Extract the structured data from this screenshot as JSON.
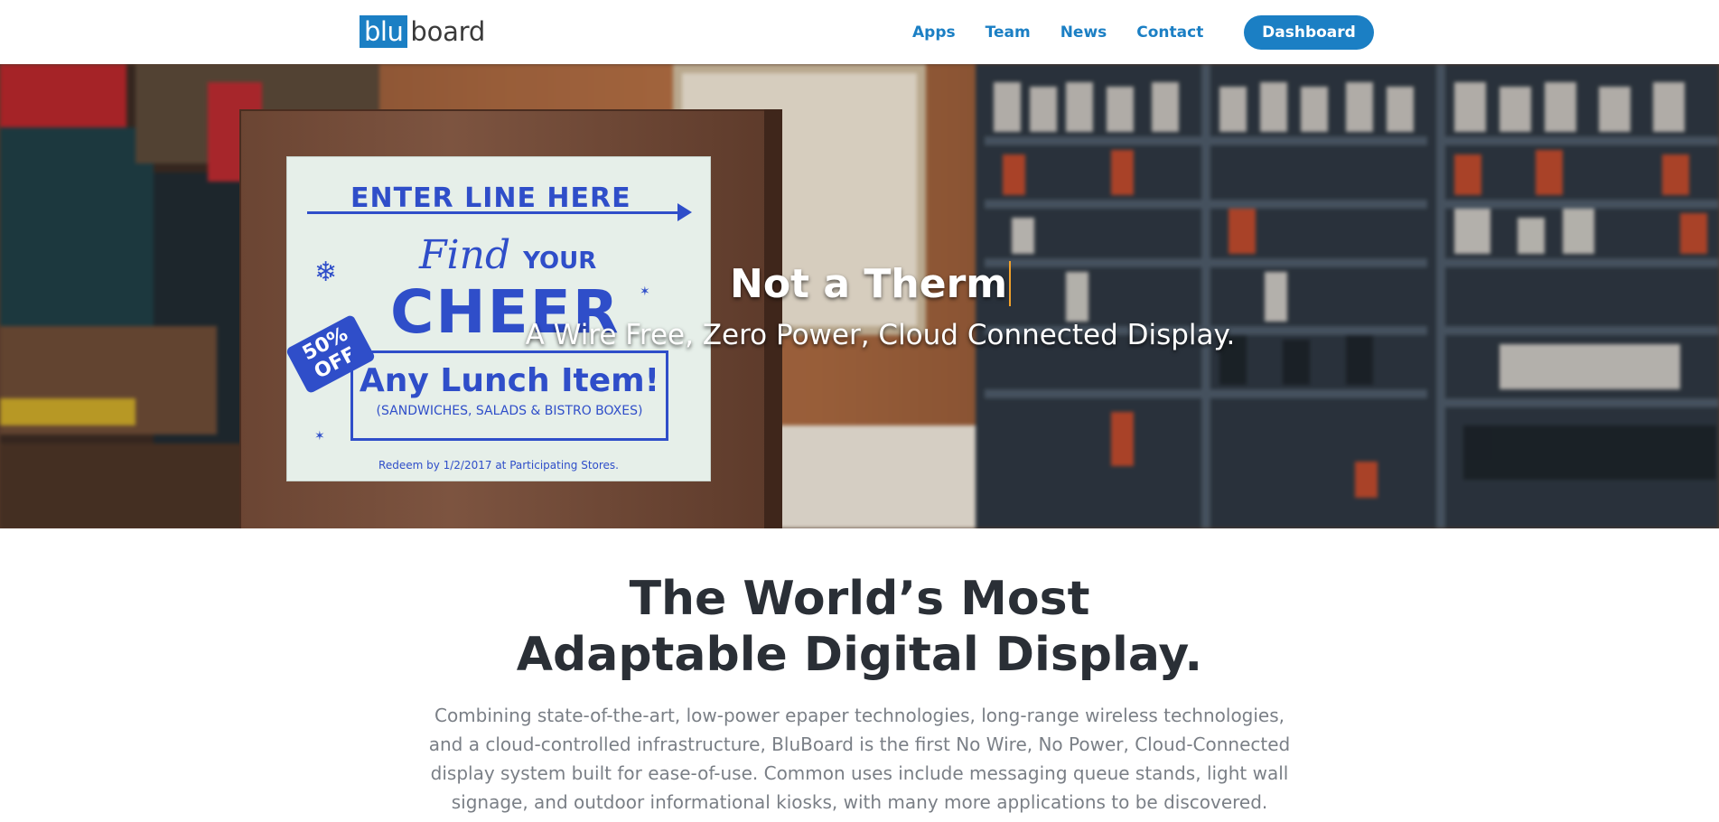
{
  "nav": {
    "logo_blu": "blu",
    "logo_board": "board",
    "links": [
      "Apps",
      "Team",
      "News",
      "Contact"
    ],
    "dashboard_label": "Dashboard"
  },
  "hero": {
    "title": "Not a Therm",
    "subtitle": "A Wire Free, Zero Power, Cloud Connected Display.",
    "sign": {
      "line1": "ENTER LINE HERE",
      "find": "Find",
      "your": "YOUR",
      "cheer": "CHEER",
      "tag": "50% OFF",
      "lunch": "Any Lunch Item!",
      "sub": "(SANDWICHES, SALADS & BISTRO BOXES)",
      "redeem": "Redeem by 1/2/2017 at Participating Stores."
    }
  },
  "section": {
    "title_line1": "The World’s Most",
    "title_line2": "Adaptable Digital Display.",
    "body": "Combining state-of-the-art, low-power epaper technologies, long-range wireless technologies, and a cloud-controlled infrastructure, BluBoard is the first No Wire, No Power, Cloud-Connected display system built for ease-of-use. Common uses include messaging queue stands, light wall signage, and outdoor informational kiosks, with many more applications to be discovered."
  },
  "colors": {
    "brand_blue": "#1b7fc4",
    "heading": "#2a2f36",
    "body_text": "#7a7f86",
    "cursor": "#f2a12a"
  }
}
